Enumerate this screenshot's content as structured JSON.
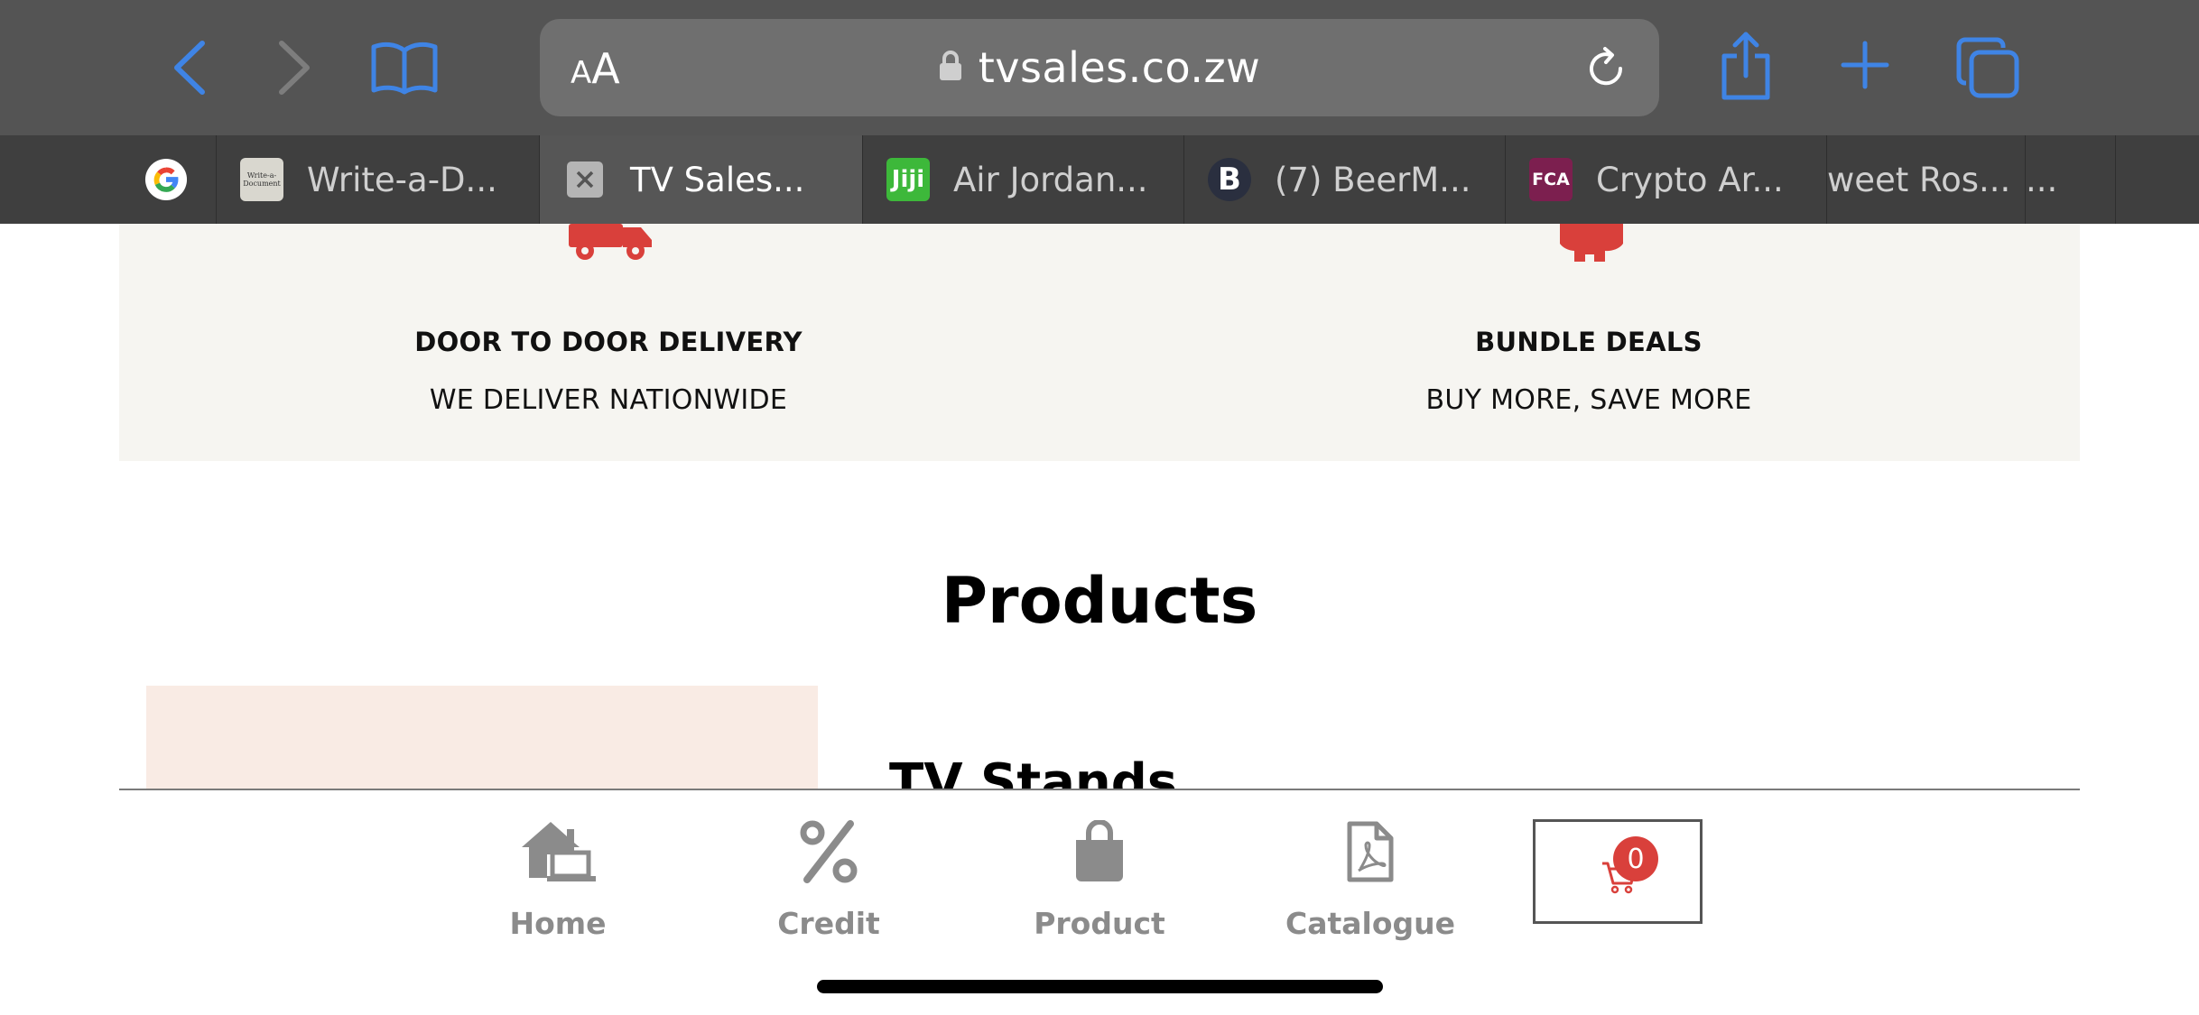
{
  "browser": {
    "text_size_button": {
      "small": "A",
      "large": "A"
    },
    "url": "tvsales.co.zw",
    "tabs": [
      {
        "label": "",
        "favicon": "google-icon"
      },
      {
        "label": "Write-a-D...",
        "favicon": "write-a-document-icon",
        "favicon_text": "Write-a-Document"
      },
      {
        "label": "TV Sales...",
        "favicon": "close-tab-icon",
        "active": true
      },
      {
        "label": "Air Jordan...",
        "favicon": "jiji-icon",
        "favicon_text": "Jiji"
      },
      {
        "label": "(7) BeerM...",
        "favicon": "beermoney-icon",
        "favicon_text": "B"
      },
      {
        "label": "Crypto Ar...",
        "favicon": "fca-icon",
        "favicon_text": "FCA"
      },
      {
        "label": "weet Ros...",
        "favicon": ""
      },
      {
        "label": "...",
        "favicon": ""
      }
    ]
  },
  "features": [
    {
      "title": "DOOR TO DOOR DELIVERY",
      "subtitle": "WE DELIVER NATIONWIDE",
      "icon": "delivery-truck-icon"
    },
    {
      "title": "BUNDLE DEALS",
      "subtitle": "BUY MORE, SAVE MORE",
      "icon": "piggy-bank-icon"
    }
  ],
  "products": {
    "heading": "Products",
    "first_category": "TV Stands"
  },
  "bottom_nav": {
    "items": [
      {
        "label": "Home",
        "icon": "home-laptop-icon"
      },
      {
        "label": "Credit",
        "icon": "percent-icon"
      },
      {
        "label": "Product",
        "icon": "shopping-bag-icon"
      },
      {
        "label": "Catalogue",
        "icon": "pdf-file-icon"
      }
    ],
    "cart_count": "0"
  },
  "colors": {
    "accent_red": "#d9403b",
    "safari_blue": "#3f84e5",
    "feature_bg": "#f6f5f1",
    "product_image_bg": "#f9ebe4"
  }
}
